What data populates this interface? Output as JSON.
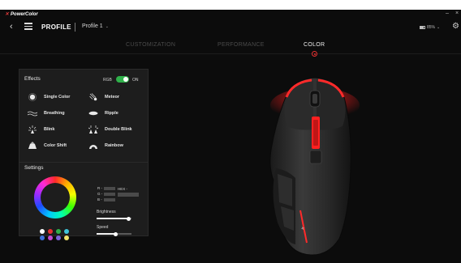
{
  "app": {
    "brand": "PowerColor"
  },
  "header": {
    "title": "PROFILE",
    "profile": "Profile 1",
    "battery": "85%"
  },
  "tabs": [
    {
      "label": "CUSTOMIZATION",
      "active": false
    },
    {
      "label": "PERFORMANCE",
      "active": false
    },
    {
      "label": "COLOR",
      "active": true
    }
  ],
  "effects": {
    "title": "Effects",
    "rgb_label": "RGB",
    "rgb_state": "ON",
    "rgb_on": true,
    "items": [
      {
        "label": "Single Color",
        "icon": "single-color-icon"
      },
      {
        "label": "Meteor",
        "icon": "meteor-icon"
      },
      {
        "label": "Breathing",
        "icon": "breathing-icon"
      },
      {
        "label": "Ripple",
        "icon": "ripple-icon"
      },
      {
        "label": "Blink",
        "icon": "blink-icon"
      },
      {
        "label": "Double Blink",
        "icon": "double-blink-icon"
      },
      {
        "label": "Color Shift",
        "icon": "color-shift-icon"
      },
      {
        "label": "Rainbow",
        "icon": "rainbow-icon"
      }
    ]
  },
  "settings": {
    "title": "Settings",
    "r_label": "R -",
    "g_label": "G -",
    "b_label": "B -",
    "hex_label": "HEX -",
    "brightness_label": "Brightness",
    "brightness_level": 0.92,
    "speed_label": "Speed",
    "speed_level": 0.55,
    "swatches": [
      "#ffffff",
      "#e53030",
      "#2fb14a",
      "#3fc3d8",
      "#3e6fd9",
      "#c24ad2",
      "#7b62d9",
      "#f0e26a"
    ]
  },
  "colors": {
    "accent": "#e53030",
    "toggle_on": "#2fb14a",
    "mouse_glow": "#ff1e1e"
  }
}
